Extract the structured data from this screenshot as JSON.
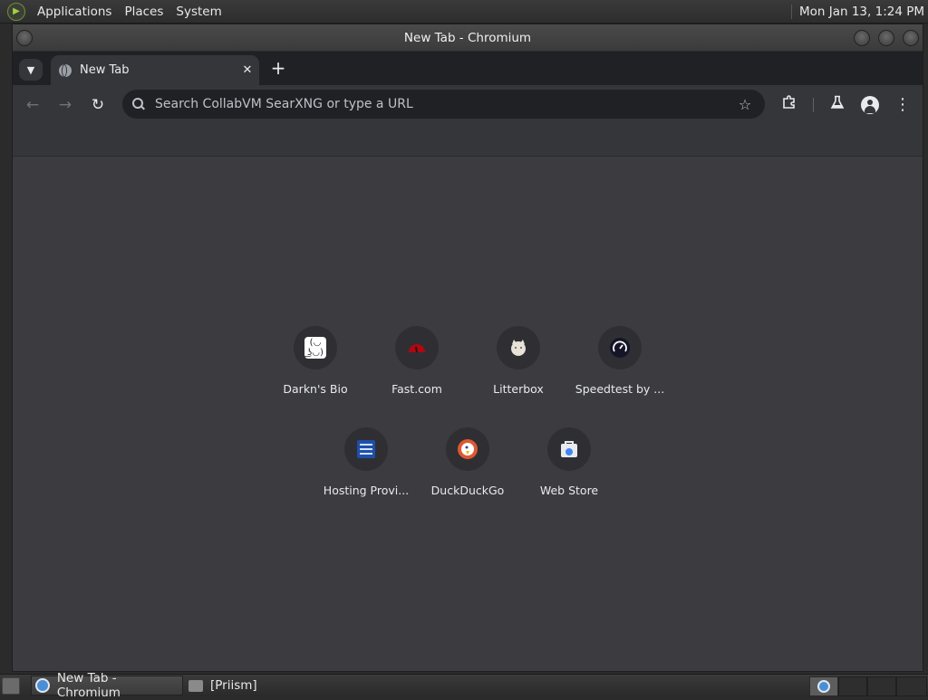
{
  "top_panel": {
    "menus": [
      "Applications",
      "Places",
      "System"
    ],
    "clock": "Mon Jan 13,  1:24 PM"
  },
  "window": {
    "title": "New Tab - Chromium"
  },
  "tabs": [
    {
      "title": "New Tab"
    }
  ],
  "omnibox": {
    "placeholder": "Search CollabVM SearXNG or type a URL"
  },
  "shortcuts": [
    {
      "label": "Darkn's Bio",
      "icon": "darkns-bio-icon",
      "color": "#ffffff"
    },
    {
      "label": "Fast.com",
      "icon": "fast-speedometer-icon",
      "color": "#e50914"
    },
    {
      "label": "Litterbox",
      "icon": "litterbox-cat-icon",
      "color": "#f2ece4"
    },
    {
      "label": "Speedtest by ...",
      "icon": "speedtest-gauge-icon",
      "color": "#141526"
    },
    {
      "label": "Hosting Provi...",
      "icon": "hosting-provider-icon",
      "color": "#1f4fa8"
    },
    {
      "label": "DuckDuckGo",
      "icon": "duckduckgo-icon",
      "color": "#de5833"
    },
    {
      "label": "Web Store",
      "icon": "web-store-icon",
      "color": "#4285f4"
    }
  ],
  "taskbar": {
    "items": [
      {
        "label": "New Tab - Chromium",
        "icon": "chromium-icon",
        "active": true
      },
      {
        "label": "[Priism]",
        "icon": "folder-icon",
        "active": false
      }
    ]
  },
  "colors": {
    "content_bg": "#3c3c40",
    "toolbar_bg": "#35363a",
    "tabstrip_bg": "#202124"
  }
}
